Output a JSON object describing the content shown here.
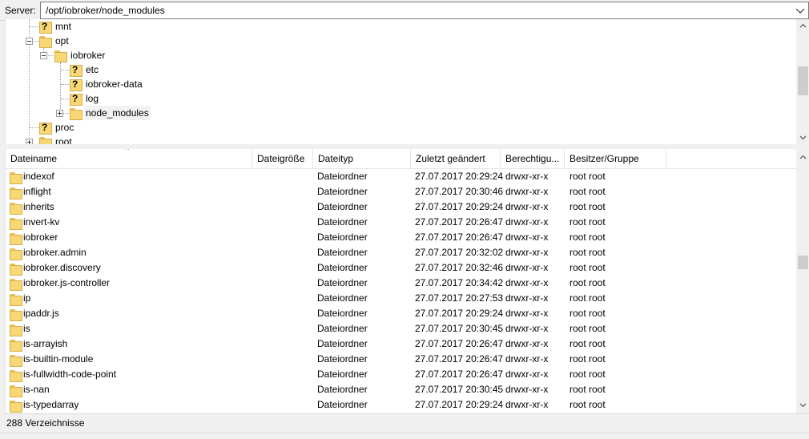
{
  "server_bar": {
    "label": "Server:",
    "path": "/opt/iobroker/node_modules"
  },
  "tree": {
    "items": [
      {
        "label": "mnt",
        "icon": "unknown-folder-icon"
      },
      {
        "label": "opt",
        "icon": "folder-icon",
        "expander": "minus"
      },
      {
        "label": "iobroker",
        "icon": "folder-icon",
        "expander": "minus"
      },
      {
        "label": "etc",
        "icon": "unknown-folder-icon"
      },
      {
        "label": "iobroker-data",
        "icon": "unknown-folder-icon"
      },
      {
        "label": "log",
        "icon": "unknown-folder-icon"
      },
      {
        "label": "node_modules",
        "icon": "folder-icon",
        "expander": "plus",
        "selected": true
      },
      {
        "label": "proc",
        "icon": "unknown-folder-icon"
      },
      {
        "label": "root",
        "icon": "folder-icon",
        "expander": "plus"
      }
    ]
  },
  "file_list": {
    "columns": [
      "Dateiname",
      "Dateigröße",
      "Dateityp",
      "Zuletzt geändert",
      "Berechtigu...",
      "Besitzer/Gruppe"
    ],
    "rows": [
      {
        "name": "indexof",
        "size": "",
        "type": "Dateiordner",
        "modified": "27.07.2017 20:29:24",
        "perms": "drwxr-xr-x",
        "owner": "root root"
      },
      {
        "name": "inflight",
        "size": "",
        "type": "Dateiordner",
        "modified": "27.07.2017 20:30:46",
        "perms": "drwxr-xr-x",
        "owner": "root root"
      },
      {
        "name": "inherits",
        "size": "",
        "type": "Dateiordner",
        "modified": "27.07.2017 20:29:24",
        "perms": "drwxr-xr-x",
        "owner": "root root"
      },
      {
        "name": "invert-kv",
        "size": "",
        "type": "Dateiordner",
        "modified": "27.07.2017 20:26:47",
        "perms": "drwxr-xr-x",
        "owner": "root root"
      },
      {
        "name": "iobroker",
        "size": "",
        "type": "Dateiordner",
        "modified": "27.07.2017 20:26:47",
        "perms": "drwxr-xr-x",
        "owner": "root root"
      },
      {
        "name": "iobroker.admin",
        "size": "",
        "type": "Dateiordner",
        "modified": "27.07.2017 20:32:02",
        "perms": "drwxr-xr-x",
        "owner": "root root"
      },
      {
        "name": "iobroker.discovery",
        "size": "",
        "type": "Dateiordner",
        "modified": "27.07.2017 20:32:46",
        "perms": "drwxr-xr-x",
        "owner": "root root"
      },
      {
        "name": "iobroker.js-controller",
        "size": "",
        "type": "Dateiordner",
        "modified": "27.07.2017 20:34:42",
        "perms": "drwxr-xr-x",
        "owner": "root root"
      },
      {
        "name": "ip",
        "size": "",
        "type": "Dateiordner",
        "modified": "27.07.2017 20:27:53",
        "perms": "drwxr-xr-x",
        "owner": "root root"
      },
      {
        "name": "ipaddr.js",
        "size": "",
        "type": "Dateiordner",
        "modified": "27.07.2017 20:29:24",
        "perms": "drwxr-xr-x",
        "owner": "root root"
      },
      {
        "name": "is",
        "size": "",
        "type": "Dateiordner",
        "modified": "27.07.2017 20:30:45",
        "perms": "drwxr-xr-x",
        "owner": "root root"
      },
      {
        "name": "is-arrayish",
        "size": "",
        "type": "Dateiordner",
        "modified": "27.07.2017 20:26:47",
        "perms": "drwxr-xr-x",
        "owner": "root root"
      },
      {
        "name": "is-builtin-module",
        "size": "",
        "type": "Dateiordner",
        "modified": "27.07.2017 20:26:47",
        "perms": "drwxr-xr-x",
        "owner": "root root"
      },
      {
        "name": "is-fullwidth-code-point",
        "size": "",
        "type": "Dateiordner",
        "modified": "27.07.2017 20:26:47",
        "perms": "drwxr-xr-x",
        "owner": "root root"
      },
      {
        "name": "is-nan",
        "size": "",
        "type": "Dateiordner",
        "modified": "27.07.2017 20:30:45",
        "perms": "drwxr-xr-x",
        "owner": "root root"
      },
      {
        "name": "is-typedarray",
        "size": "",
        "type": "Dateiordner",
        "modified": "27.07.2017 20:29:24",
        "perms": "drwxr-xr-x",
        "owner": "root root"
      }
    ]
  },
  "status_bar": {
    "text": "288 Verzeichnisse"
  },
  "colors": {
    "folder": "#f8d775",
    "folder_border": "#d7ae4a",
    "scroll_thumb": "#cdcdcd"
  }
}
